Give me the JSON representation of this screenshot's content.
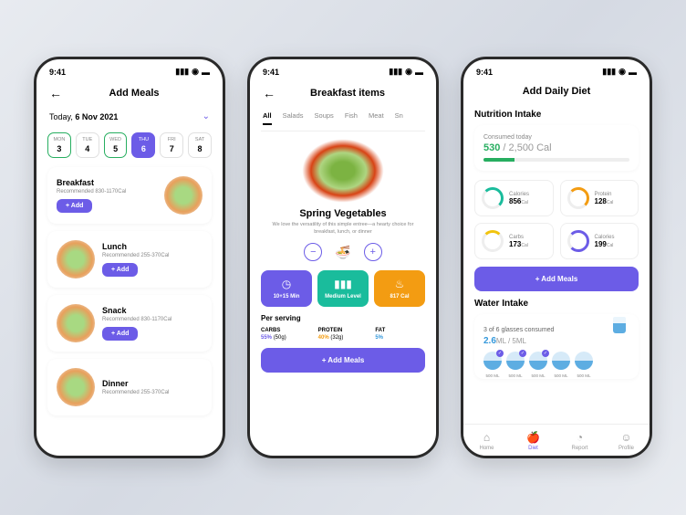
{
  "status": {
    "time": "9:41"
  },
  "screen1": {
    "title": "Add Meals",
    "date_prefix": "Today, ",
    "date_value": "6 Nov 2021",
    "days": [
      {
        "dow": "MON",
        "num": "3"
      },
      {
        "dow": "TUE",
        "num": "4"
      },
      {
        "dow": "WED",
        "num": "5"
      },
      {
        "dow": "THU",
        "num": "6"
      },
      {
        "dow": "FRI",
        "num": "7"
      },
      {
        "dow": "SAT",
        "num": "8"
      }
    ],
    "meals": {
      "breakfast": {
        "name": "Breakfast",
        "rec": "Recommended 830-1170Cal"
      },
      "lunch": {
        "name": "Lunch",
        "rec": "Recommended 255-370Cal"
      },
      "snack": {
        "name": "Snack",
        "rec": "Recommended 830-1170Cal"
      },
      "dinner": {
        "name": "Dinner",
        "rec": "Recommended 255-370Cal"
      }
    },
    "add_btn": "+ Add"
  },
  "screen2": {
    "title": "Breakfast items",
    "tabs": [
      "All",
      "Salads",
      "Soups",
      "Fish",
      "Meat",
      "Sn"
    ],
    "dish": "Spring Vegetables",
    "desc": "We love the versatility of this simple entree—a hearty choice for breakfast, lunch, or dinner",
    "stats": {
      "time": "10+15 Min",
      "level": "Medium Level",
      "cal": "817 Cal"
    },
    "per_serving": "Per serving",
    "serving": {
      "carbs": {
        "name": "CARBS",
        "pct": "55%",
        "g": "(50g)"
      },
      "protein": {
        "name": "Protein",
        "pct": "40%",
        "g": "(32g)"
      },
      "fat": {
        "name": "Fat",
        "pct": "5%"
      }
    },
    "add_meals": "+ Add Meals"
  },
  "screen3": {
    "title": "Add Daily Diet",
    "nutrition": "Nutrition Intake",
    "consumed_label": "Consumed today",
    "consumed": "530",
    "goal": " / 2,500 Cal",
    "rings": {
      "calories": {
        "label": "Calories",
        "value": "856",
        "unit": "Cal"
      },
      "protein": {
        "label": "Protein",
        "value": "128",
        "unit": "Cal"
      },
      "carbs": {
        "label": "Carbs",
        "value": "173",
        "unit": "Cal"
      },
      "calories2": {
        "label": "Calories",
        "value": "199",
        "unit": "Cal"
      }
    },
    "add_meals": "+ Add Meals",
    "water": "Water Intake",
    "water_text": "3 of 6 glasses consumed",
    "water_val": "2.6",
    "water_unit": "ML",
    "water_goal": " / 5",
    "water_goal_unit": "ML",
    "glass_ml": "500 ML",
    "nav": {
      "home": "Home",
      "diet": "Diet",
      "report": "Report",
      "profile": "Profile"
    }
  }
}
